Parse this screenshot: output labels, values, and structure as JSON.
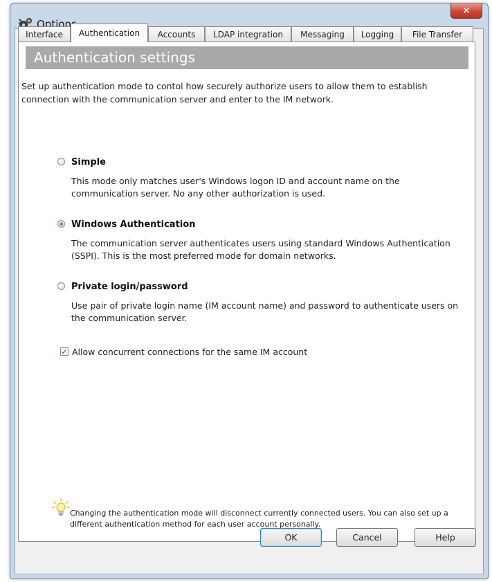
{
  "window": {
    "title": "Options",
    "app_icon": "gears-icon",
    "close_glyph": "✕"
  },
  "tabs": [
    {
      "label": "Interface",
      "active": false
    },
    {
      "label": "Authentication",
      "active": true
    },
    {
      "label": "Accounts",
      "active": false
    },
    {
      "label": "LDAP integration",
      "active": false
    },
    {
      "label": "Messaging",
      "active": false
    },
    {
      "label": "Logging",
      "active": false
    },
    {
      "label": "File Transfer",
      "active": false
    }
  ],
  "panel": {
    "title": "Authentication settings",
    "intro": "Set up authentication mode to contol how securely authorize users to allow them to establish connection with the communication server and enter to the IM network.",
    "options": [
      {
        "label": "Simple",
        "selected": false,
        "description": "This mode only matches user's Windows logon ID and account name on the communication server. No any other authorization is used."
      },
      {
        "label": "Windows Authentication",
        "selected": true,
        "description": "The communication server authenticates users using standard Windows Authentication (SSPI). This is the most preferred mode for domain networks."
      },
      {
        "label": "Private login/password",
        "selected": false,
        "description": "Use pair of private login name (IM account name) and password to authenticate users on the communication server."
      }
    ],
    "concurrent": {
      "label": "Allow concurrent connections for the same IM account",
      "checked": true
    },
    "note": "Changing the authentication mode will disconnect currently connected users. You can also set up a different authentication method for each user account personally.",
    "note_icon": "lightbulb-icon"
  },
  "buttons": {
    "ok": "OK",
    "cancel": "Cancel",
    "help": "Help"
  },
  "colors": {
    "header_band": "#a9a9a9",
    "window_frame": "#c9d9ea",
    "close_button": "#c9463a"
  }
}
